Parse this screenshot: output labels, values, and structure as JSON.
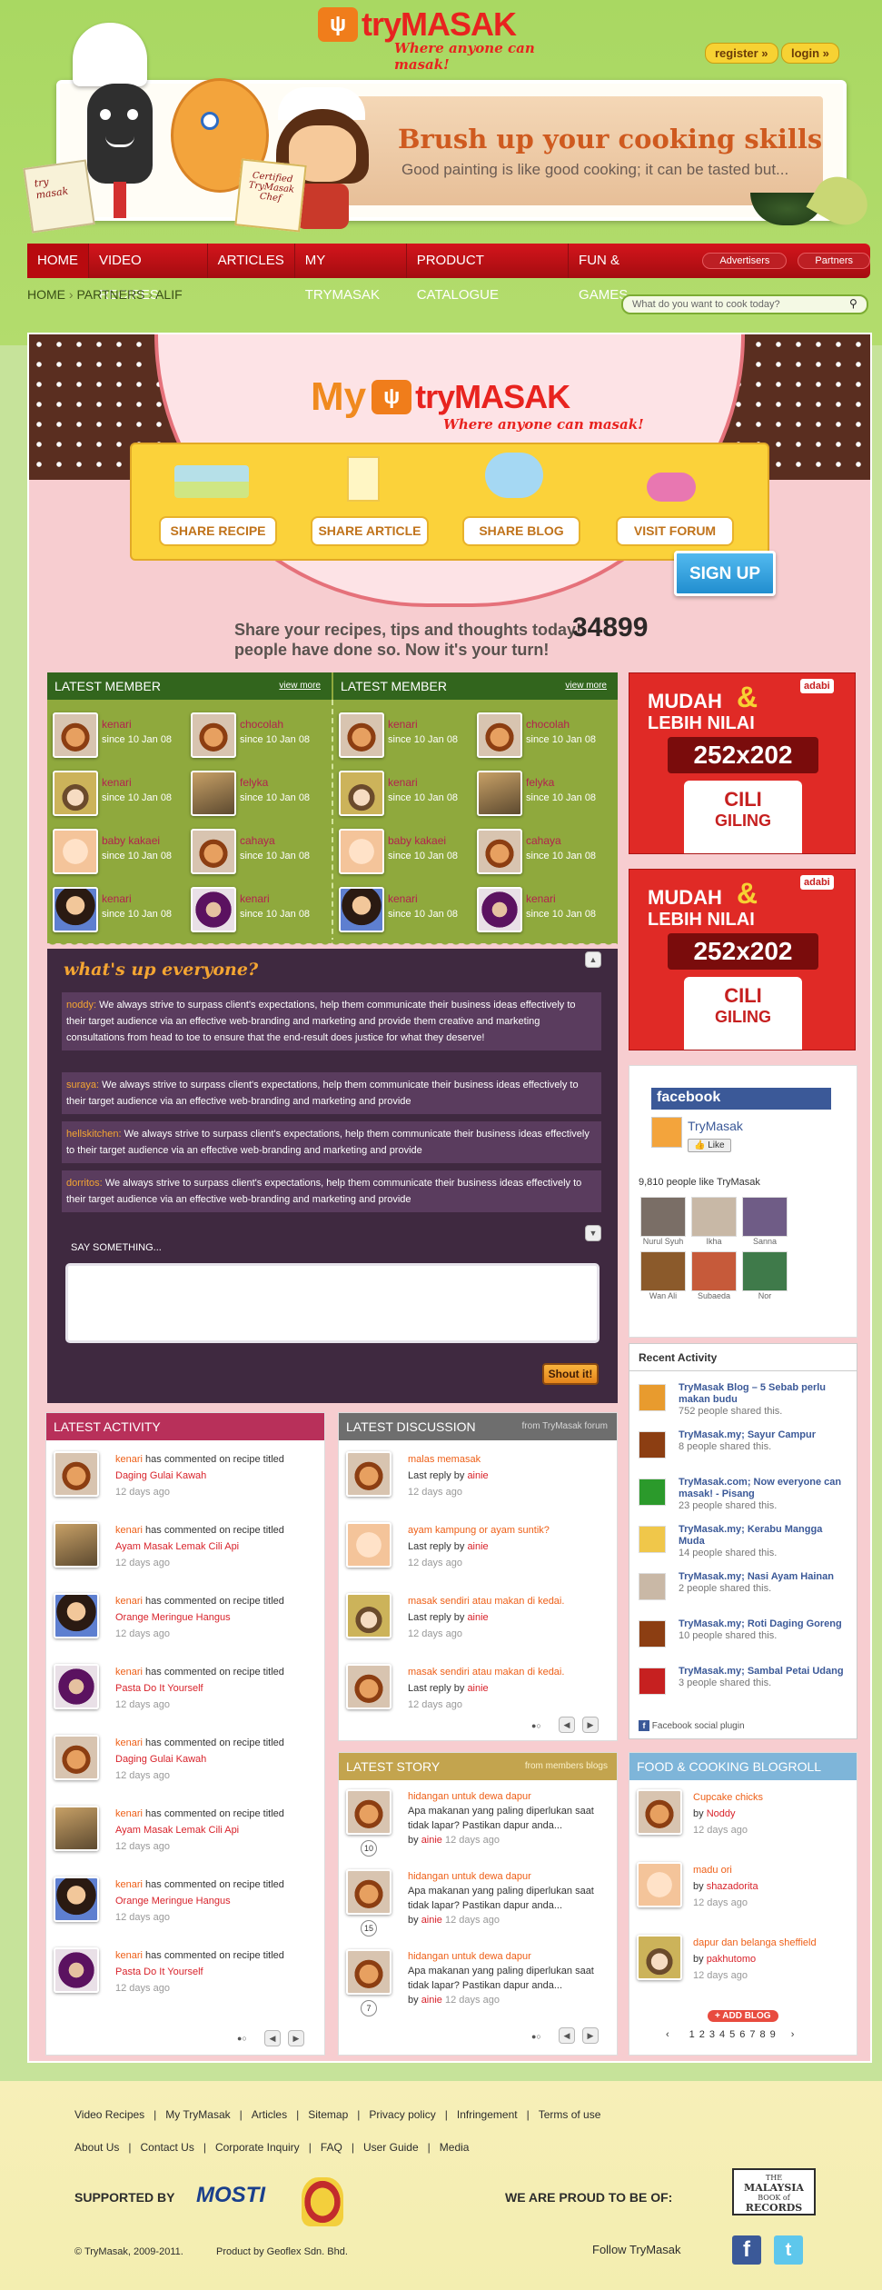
{
  "header": {
    "logo_try": "try",
    "logo_masak": "MASAK",
    "tagline": "Where anyone can masak!",
    "register": "register »",
    "login": "login »",
    "banner_title": "Brush up your cooking skills",
    "banner_subtitle": "Good painting is like good cooking; it can be tasted but...",
    "certificate": "Certified TryMasak Chef",
    "book": "try masak"
  },
  "nav": {
    "items": [
      "HOME",
      "VIDEO RECIPES",
      "ARTICLES",
      "MY TRYMASAK",
      "PRODUCT CATALOGUE",
      "FUN & GAMES"
    ],
    "pills": [
      "Advertisers",
      "Partners"
    ]
  },
  "breadcrumb": [
    "HOME",
    "PARTNERS",
    "ALIF"
  ],
  "search": {
    "placeholder": "What do you want to cook today?"
  },
  "my": {
    "logo_my": "My",
    "share": [
      "SHARE RECIPE",
      "SHARE ARTICLE",
      "SHARE BLOG",
      "VISIT FORUM"
    ],
    "signup": "SIGN UP",
    "cta_line1": "Share your recipes, tips and thoughts today!",
    "cta_line2": "people have done so. Now it's your turn!",
    "count": "34899"
  },
  "latest_member": {
    "title": "LATEST MEMBER",
    "view_more": "view more",
    "members": [
      {
        "name": "kenari",
        "since": "since 10 Jan 08",
        "av": "soup"
      },
      {
        "name": "chocolah",
        "since": "since 10 Jan 08",
        "av": "soup"
      },
      {
        "name": "kenari",
        "since": "since 10 Jan 08",
        "av": "hat"
      },
      {
        "name": "felyka",
        "since": "since 10 Jan 08",
        "av": "box"
      },
      {
        "name": "baby kakaei",
        "since": "since 10 Jan 08",
        "av": "baby"
      },
      {
        "name": "cahaya",
        "since": "since 10 Jan 08",
        "av": "soup"
      },
      {
        "name": "kenari",
        "since": "since 10 Jan 08",
        "av": "girl"
      },
      {
        "name": "kenari",
        "since": "since 10 Jan 08",
        "av": "dark"
      }
    ]
  },
  "shoutbox": {
    "title": "what's up everyone?",
    "say": "SAY SOMETHING...",
    "button": "Shout it!",
    "posts": [
      {
        "user": "noddy:",
        "text": "We always strive to surpass client's expectations, help them communicate their business ideas effectively to their target audience via an effective web-branding and marketing and provide them creative and marketing consultations from head to toe to ensure that the end-result does justice for what they deserve!"
      },
      {
        "user": "suraya:",
        "text": "We always strive to surpass client's expectations, help them communicate their business ideas effectively to their target audience via an effective web-branding and marketing and provide"
      },
      {
        "user": "hellskitchen:",
        "text": "We always strive to surpass client's expectations, help them communicate their business ideas effectively to their target audience via an effective web-branding and marketing and provide"
      },
      {
        "user": "dorritos:",
        "text": "We always strive to surpass client's expectations, help them communicate their business ideas effectively to their target audience via an effective web-branding and marketing and provide"
      }
    ]
  },
  "ads": {
    "line1": "MUDAH",
    "amp": "&",
    "line2": "LEBIH NILAI",
    "brand": "adabi",
    "size": "252x202",
    "product": "CILI",
    "product2": "GILING"
  },
  "facebook": {
    "title": "facebook",
    "page": "TryMasak",
    "like": "Like",
    "count": "9,810 people like TryMasak",
    "fans": [
      "Nurul Syuh",
      "Ikha",
      "Sanna",
      "Wan Ali",
      "Subaeda",
      "Nor"
    ],
    "plugin": "Facebook social plugin"
  },
  "recent_activity": {
    "title": "Recent Activity",
    "items": [
      {
        "t": "TryMasak Blog – 5 Sebab perlu makan budu",
        "c": "752 people shared this."
      },
      {
        "t": "TryMasak.my; Sayur Campur",
        "c": "8 people shared this."
      },
      {
        "t": "TryMasak.com; Now everyone can masak! - Pisang",
        "c": "23 people shared this."
      },
      {
        "t": "TryMasak.my; Kerabu Mangga Muda",
        "c": "14 people shared this."
      },
      {
        "t": "TryMasak.my; Nasi Ayam Hainan",
        "c": "2 people shared this."
      },
      {
        "t": "TryMasak.my; Roti Daging Goreng",
        "c": "10 people shared this."
      },
      {
        "t": "TryMasak.my; Sambal Petai Udang",
        "c": "3 people shared this."
      }
    ]
  },
  "latest_activity": {
    "title": "LATEST ACTIVITY",
    "verb": "has commented on",
    "obj": "recipe titled",
    "items": [
      {
        "user": "kenari",
        "recipe": "Daging Gulai Kawah",
        "time": "12 days ago",
        "av": "soup"
      },
      {
        "user": "kenari",
        "recipe": "Ayam Masak Lemak Cili Api",
        "time": "12 days ago",
        "av": "box"
      },
      {
        "user": "kenari",
        "recipe": "Orange Meringue Hangus",
        "time": "12 days ago",
        "av": "girl"
      },
      {
        "user": "kenari",
        "recipe": "Pasta Do It Yourself",
        "time": "12 days ago",
        "av": "dark"
      },
      {
        "user": "kenari",
        "recipe": "Daging Gulai Kawah",
        "time": "12 days ago",
        "av": "soup"
      },
      {
        "user": "kenari",
        "recipe": "Ayam Masak Lemak Cili Api",
        "time": "12 days ago",
        "av": "box"
      },
      {
        "user": "kenari",
        "recipe": "Orange Meringue Hangus",
        "time": "12 days ago",
        "av": "girl"
      },
      {
        "user": "kenari",
        "recipe": "Pasta Do It Yourself",
        "time": "12 days ago",
        "av": "dark"
      }
    ]
  },
  "latest_discussion": {
    "title": "LATEST DISCUSSION",
    "from": "from TryMasak forum",
    "reply": "Last reply by",
    "items": [
      {
        "title": "malas memasak",
        "user": "ainie",
        "time": "12 days ago",
        "av": "soup"
      },
      {
        "title": "ayam kampung or ayam suntik?",
        "user": "ainie",
        "time": "12 days ago",
        "av": "baby"
      },
      {
        "title": "masak sendiri atau makan di kedai.",
        "user": "ainie",
        "time": "12 days ago",
        "av": "hat"
      },
      {
        "title": "masak sendiri atau makan di kedai.",
        "user": "ainie",
        "time": "12 days ago",
        "av": "soup"
      }
    ]
  },
  "latest_story": {
    "title": "LATEST STORY",
    "from": "from members blogs",
    "by": "by",
    "items": [
      {
        "title": "hidangan untuk dewa dapur",
        "text": "Apa makanan yang paling diperlukan saat tidak lapar? Pastikan dapur anda...",
        "user": "ainie",
        "time": "12 days ago",
        "num": "10"
      },
      {
        "title": "hidangan untuk dewa dapur",
        "text": "Apa makanan yang paling diperlukan saat tidak lapar? Pastikan dapur anda...",
        "user": "ainie",
        "time": "12 days ago",
        "num": "15"
      },
      {
        "title": "hidangan untuk dewa dapur",
        "text": "Apa makanan yang paling diperlukan saat tidak lapar? Pastikan dapur anda...",
        "user": "ainie",
        "time": "12 days ago",
        "num": "7"
      }
    ]
  },
  "blogroll": {
    "title": "FOOD & COOKING BLOGROLL",
    "by": "by",
    "add": "+ ADD BLOG",
    "pages": [
      "1",
      "2",
      "3",
      "4",
      "5",
      "6",
      "7",
      "8",
      "9"
    ],
    "items": [
      {
        "title": "Cupcake chicks",
        "user": "Noddy",
        "time": "12 days ago",
        "av": "soup"
      },
      {
        "title": "madu ori",
        "user": "shazadorita",
        "time": "12 days ago",
        "av": "baby"
      },
      {
        "title": "dapur dan belanga sheffield",
        "user": "pakhutomo",
        "time": "12 days ago",
        "av": "hat"
      }
    ]
  },
  "footer": {
    "links1": [
      "Video Recipes",
      "My TryMasak",
      "Articles",
      "Sitemap",
      "Privacy policy",
      "Infringement",
      "Terms of use"
    ],
    "links2": [
      "About Us",
      "Contact Us",
      "Corporate Inquiry",
      "FAQ",
      "User Guide",
      "Media"
    ],
    "supported": "SUPPORTED BY",
    "mosti": "MOSTI",
    "proud": "WE ARE PROUD TO BE OF:",
    "records1": "THE",
    "records2": "MALAYSIA",
    "records3": "BOOK of",
    "records4": "RECORDS",
    "copyright": "© TryMasak, 2009-2011.",
    "produced": "Product by Geoflex Sdn. Bhd.",
    "follow": "Follow TryMasak"
  }
}
